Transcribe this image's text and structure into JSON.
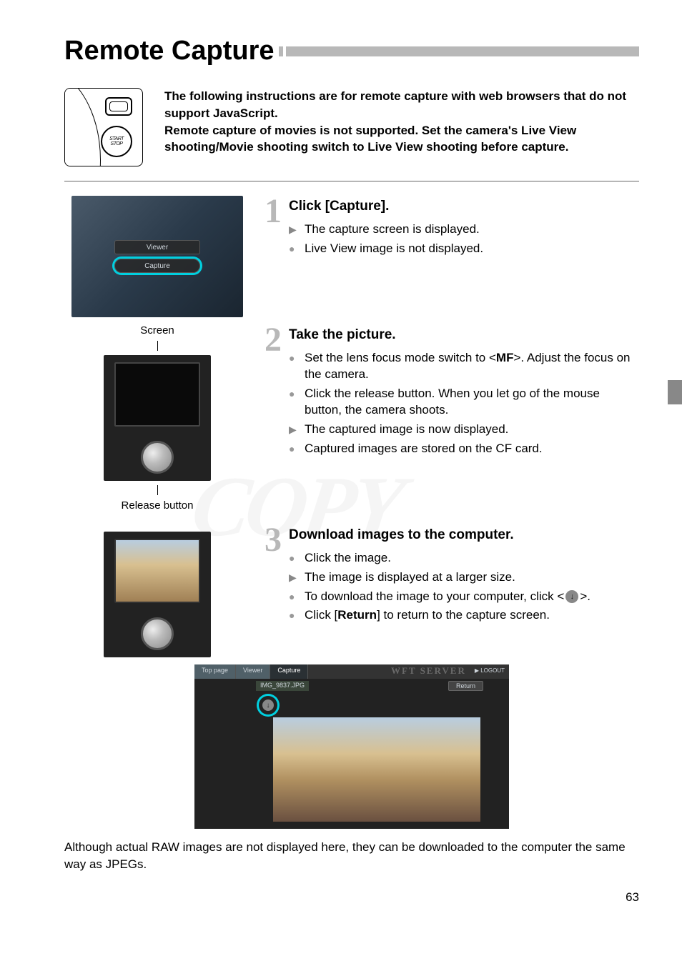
{
  "title": "Remote Capture",
  "intro_p1": "The following instructions are for remote capture with web browsers that do not support JavaScript.",
  "intro_p2": "Remote capture of movies is not supported. Set the camera's Live View shooting/Movie shooting switch to Live View shooting before capture.",
  "watermark_text": "COPY",
  "shot1": {
    "viewer_btn": "Viewer",
    "capture_btn": "Capture"
  },
  "step1": {
    "num": "1",
    "title": "Click [Capture].",
    "li1": "The capture screen is displayed.",
    "li2": "Live View image is not displayed."
  },
  "labels": {
    "screen": "Screen",
    "release": "Release button"
  },
  "step2": {
    "num": "2",
    "title": "Take the picture.",
    "li1a": "Set the lens focus mode switch to <",
    "li1_mf": "MF",
    "li1b": ">. Adjust the focus on the camera.",
    "li2": "Click the release button. When you let go of the mouse button, the camera shoots.",
    "li3": "The captured image is now displayed.",
    "li4": "Captured images are stored on the CF card."
  },
  "step3": {
    "num": "3",
    "title": "Download images to the computer.",
    "li1": "Click the image.",
    "li2": "The image is displayed at a larger size.",
    "li3a": "To download the image to your computer, click <",
    "li3b": ">.",
    "li4a": "Click [",
    "li4_btn": "Return",
    "li4b": "] to return to the capture screen."
  },
  "final_shot": {
    "tab_top": "Top page",
    "tab_viewer": "Viewer",
    "tab_capture": "Capture",
    "logo": "WFT SERVER",
    "logout": "▶ LOGOUT",
    "filename": "IMG_9837.JPG",
    "return_btn": "Return",
    "download_icon": "↓"
  },
  "note": "Although actual RAW images are not displayed here, they can be downloaded to the computer the same way as JPEGs.",
  "page_number": "63"
}
